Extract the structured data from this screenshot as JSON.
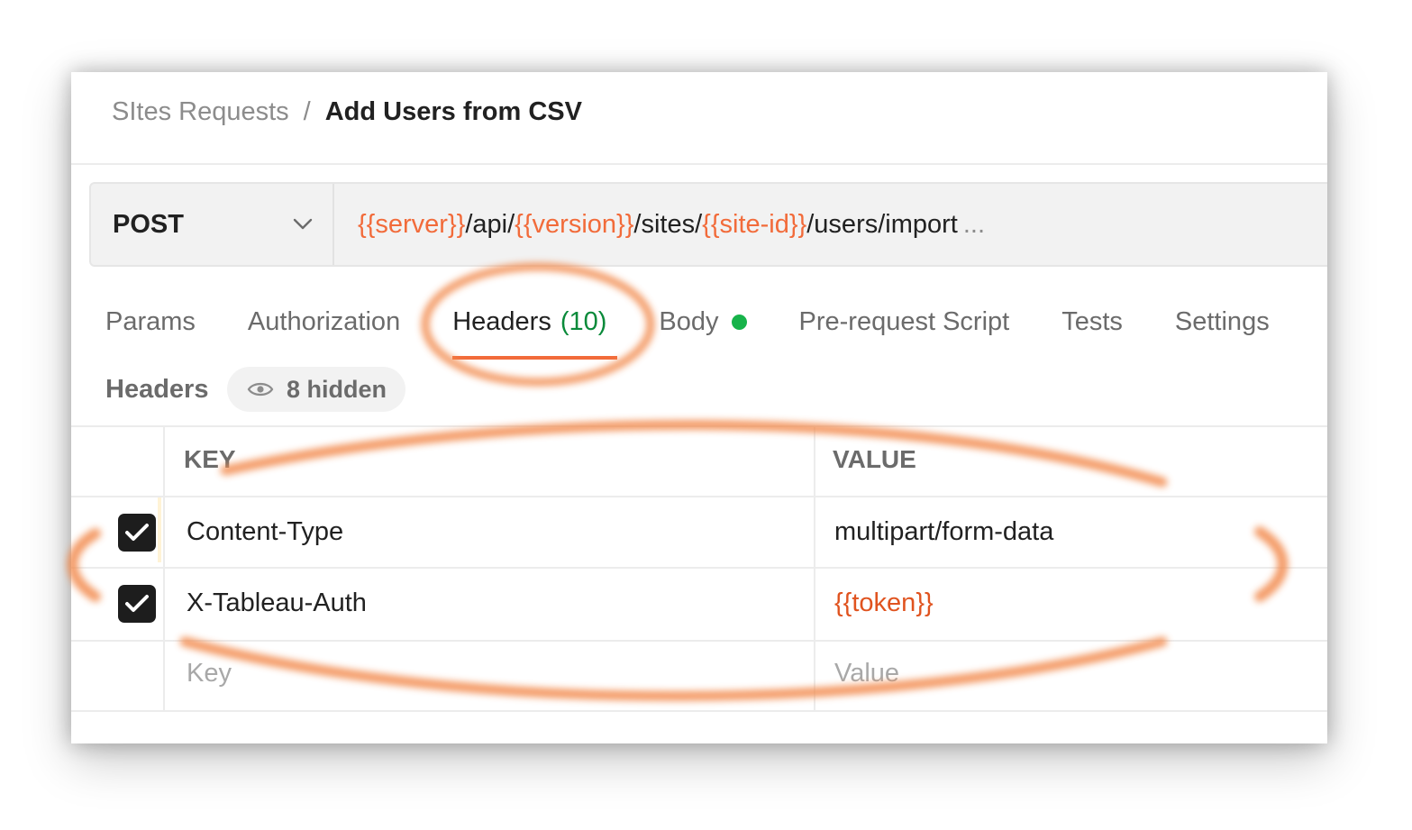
{
  "breadcrumb": {
    "parent": "SItes Requests",
    "separator": "/",
    "current": "Add Users from CSV"
  },
  "request": {
    "method": "POST",
    "url": {
      "server_var": "{{server}}",
      "seg1": "/api/",
      "version_var": "{{version}}",
      "seg2": "/sites/",
      "site_var": "{{site-id}}",
      "seg3": "/users/import",
      "ellipsis": "..."
    }
  },
  "tabs": {
    "params": "Params",
    "authorization": "Authorization",
    "headers": "Headers",
    "headers_count": "(10)",
    "body": "Body",
    "prerequest": "Pre-request Script",
    "tests": "Tests",
    "settings": "Settings"
  },
  "headers_section": {
    "label": "Headers",
    "hidden": "8 hidden"
  },
  "table": {
    "key_header": "KEY",
    "value_header": "VALUE",
    "rows": [
      {
        "key": "Content-Type",
        "value": "multipart/form-data",
        "checked": true
      },
      {
        "key": "X-Tableau-Auth",
        "value": "{{token}}",
        "checked": true
      }
    ],
    "key_placeholder": "Key",
    "value_placeholder": "Value"
  },
  "colors": {
    "accent": "#f26b3a",
    "variable": "#e0531f",
    "active_count": "#0a8a3a",
    "body_dot": "#17b34a",
    "annotation": "#f28a4e"
  },
  "icons": [
    "chevron-down-icon",
    "eye-icon",
    "check-icon"
  ]
}
